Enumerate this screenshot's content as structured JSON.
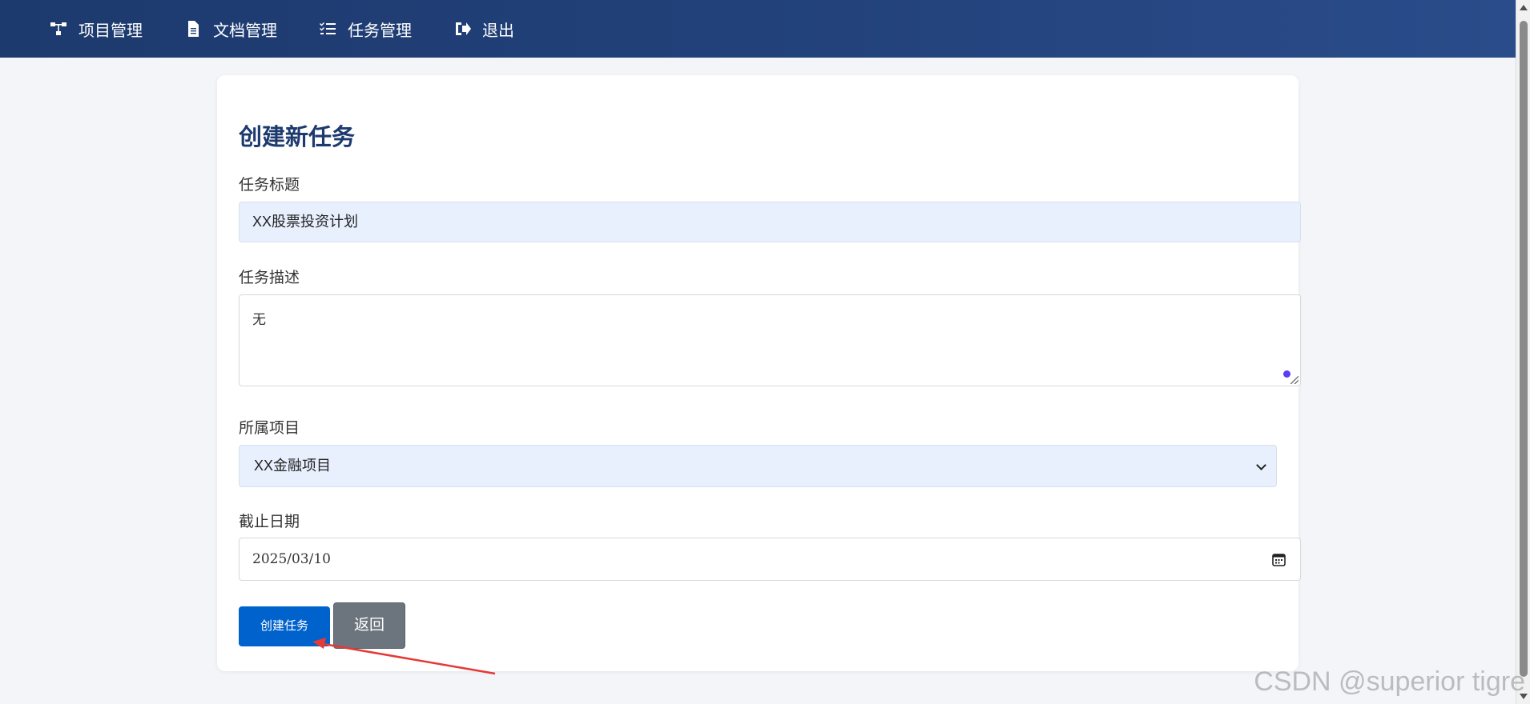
{
  "nav": {
    "items": [
      {
        "label": "项目管理",
        "icon": "sitemap-icon"
      },
      {
        "label": "文档管理",
        "icon": "file-icon"
      },
      {
        "label": "任务管理",
        "icon": "tasks-icon"
      },
      {
        "label": "退出",
        "icon": "sign-out-icon"
      }
    ]
  },
  "form": {
    "title": "创建新任务",
    "task_title_label": "任务标题",
    "task_title_value": "XX股票投资计划",
    "task_desc_label": "任务描述",
    "task_desc_value": "无",
    "project_label": "所属项目",
    "project_value": "XX金融项目",
    "due_label": "截止日期",
    "due_value": "2025/03/10",
    "create_button": "创建任务",
    "back_button": "返回"
  },
  "watermark": "CSDN @superior tigre",
  "colors": {
    "nav_bg": "#1d3a6e",
    "title": "#1d3a6e",
    "primary_button": "#0062cc",
    "secondary_button": "#6c757d",
    "input_fill": "#e8f0fe",
    "annotation_arrow": "#e53935"
  }
}
